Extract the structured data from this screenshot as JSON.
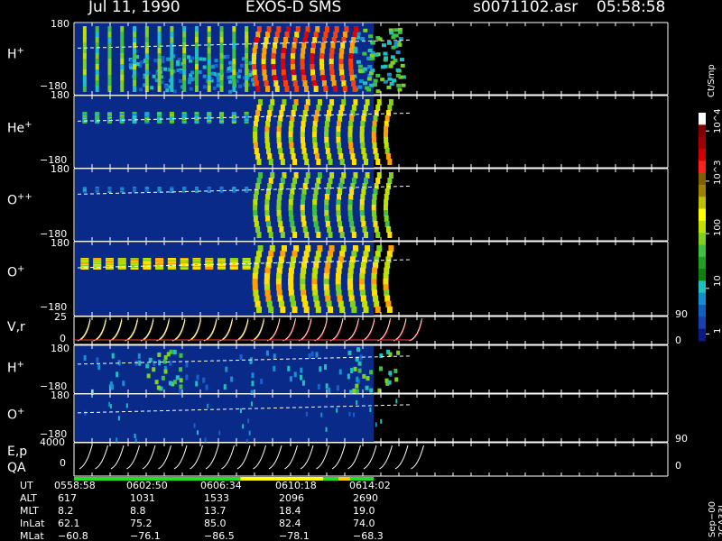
{
  "header": {
    "date": "Jul 11, 1990",
    "mission": "EXOS-D SMS",
    "file": "s0071102.asr",
    "time": "05:58:58"
  },
  "panels": [
    {
      "id": "hplus",
      "label_base": "H",
      "label_sup": "+",
      "ytop": "180",
      "ybottom": "−180"
    },
    {
      "id": "heplus",
      "label_base": "He",
      "label_sup": "+",
      "ytop": "180",
      "ybottom": "−180"
    },
    {
      "id": "oplusplus",
      "label_base": "O",
      "label_sup": "++",
      "ytop": "180",
      "ybottom": "−180"
    },
    {
      "id": "oplus",
      "label_base": "O",
      "label_sup": "+",
      "ytop": "180",
      "ybottom": "−180"
    },
    {
      "id": "vr",
      "label": "V,r",
      "ytop": "25",
      "ybottom": "0",
      "right_top": "90",
      "right_bottom": "0"
    },
    {
      "id": "hplus2",
      "label_base": "H",
      "label_sup": "+",
      "ytop": "180",
      "ybottom": "−180"
    },
    {
      "id": "oplus2",
      "label_base": "O",
      "label_sup": "+",
      "ytop": "180",
      "ybottom": "−180"
    },
    {
      "id": "ep",
      "label": "E,p",
      "label2": "QA",
      "ytop": "4000",
      "ybottom": "0",
      "right_top": "90",
      "right_bottom": "0"
    }
  ],
  "colorbar": {
    "unit": "Ct/Smp",
    "labels": [
      "10^4",
      "10^3",
      "100",
      "10",
      "1"
    ]
  },
  "footer": {
    "row_labels": [
      "UT",
      "ALT",
      "MLT",
      "InLat",
      "MLat"
    ],
    "columns": [
      {
        "UT": "0558:58",
        "ALT": "617",
        "MLT": "8.2",
        "InLat": "62.1",
        "MLat": "−60.8"
      },
      {
        "UT": "0602:50",
        "ALT": "1031",
        "MLT": "8.8",
        "InLat": "75.2",
        "MLat": "−76.1"
      },
      {
        "UT": "0606:34",
        "ALT": "1533",
        "MLT": "13.7",
        "InLat": "85.0",
        "MLat": "−86.5"
      },
      {
        "UT": "0610:18",
        "ALT": "2096",
        "MLT": "18.4",
        "InLat": "82.4",
        "MLat": "−78.1"
      },
      {
        "UT": "0614:02",
        "ALT": "2690",
        "MLT": "19.0",
        "InLat": "74.0",
        "MLat": "−68.3"
      }
    ],
    "side_note": "Sep−00 2CA33L"
  },
  "chart_data": {
    "type": "heatmap",
    "x_ticks": [
      "0558:58",
      "0602:50",
      "0606:34",
      "0610:18",
      "0614:02"
    ],
    "data_end_fraction": 0.505,
    "colorbar_ct_per_sample_range": [
      1,
      10000
    ],
    "log_scale": true,
    "qa_segments": [
      {
        "from": 0.0,
        "to": 0.28,
        "color": "#22dd22"
      },
      {
        "from": 0.28,
        "to": 0.42,
        "color": "#ffff00"
      },
      {
        "from": 0.42,
        "to": 0.445,
        "color": "#22dd22"
      },
      {
        "from": 0.445,
        "to": 0.465,
        "color": "#ffcc00"
      },
      {
        "from": 0.465,
        "to": 0.505,
        "color": "#22dd22"
      }
    ]
  }
}
